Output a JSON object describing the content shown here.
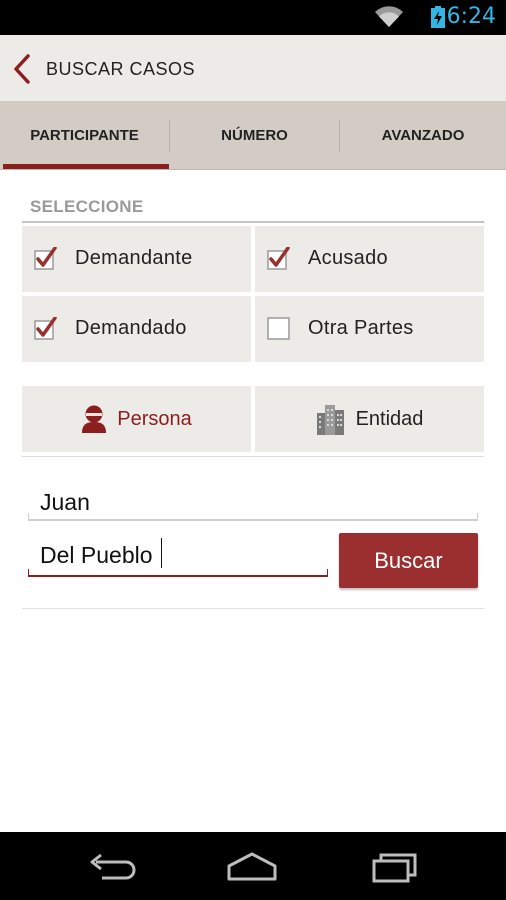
{
  "status_bar": {
    "time": "6:24",
    "time_color": "#33b5e5",
    "icons": [
      "wifi-icon",
      "battery-charging-icon"
    ]
  },
  "action_bar": {
    "title": "BUSCAR CASOS",
    "back_icon": "chevron-left-icon",
    "accent_color": "#8c1e1e"
  },
  "tabs": [
    {
      "label": "PARTICIPANTE",
      "selected": true
    },
    {
      "label": "NÚMERO",
      "selected": false
    },
    {
      "label": "AVANZADO",
      "selected": false
    }
  ],
  "section": {
    "title": "SELECCIONE"
  },
  "roles": [
    {
      "label": "Demandante",
      "checked": true
    },
    {
      "label": "Acusado",
      "checked": true
    },
    {
      "label": "Demandado",
      "checked": true
    },
    {
      "label": "Otra Partes",
      "checked": false
    }
  ],
  "entity_type": {
    "options": [
      {
        "label": "Persona",
        "icon": "person-icon",
        "selected": true
      },
      {
        "label": "Entidad",
        "icon": "building-icon",
        "selected": false
      }
    ]
  },
  "form": {
    "first_name_value": "Juan",
    "last_name_value": "Del Pueblo",
    "search_label": "Buscar"
  },
  "nav_bar": {
    "icons": [
      "back-icon",
      "home-icon",
      "recent-apps-icon"
    ]
  }
}
